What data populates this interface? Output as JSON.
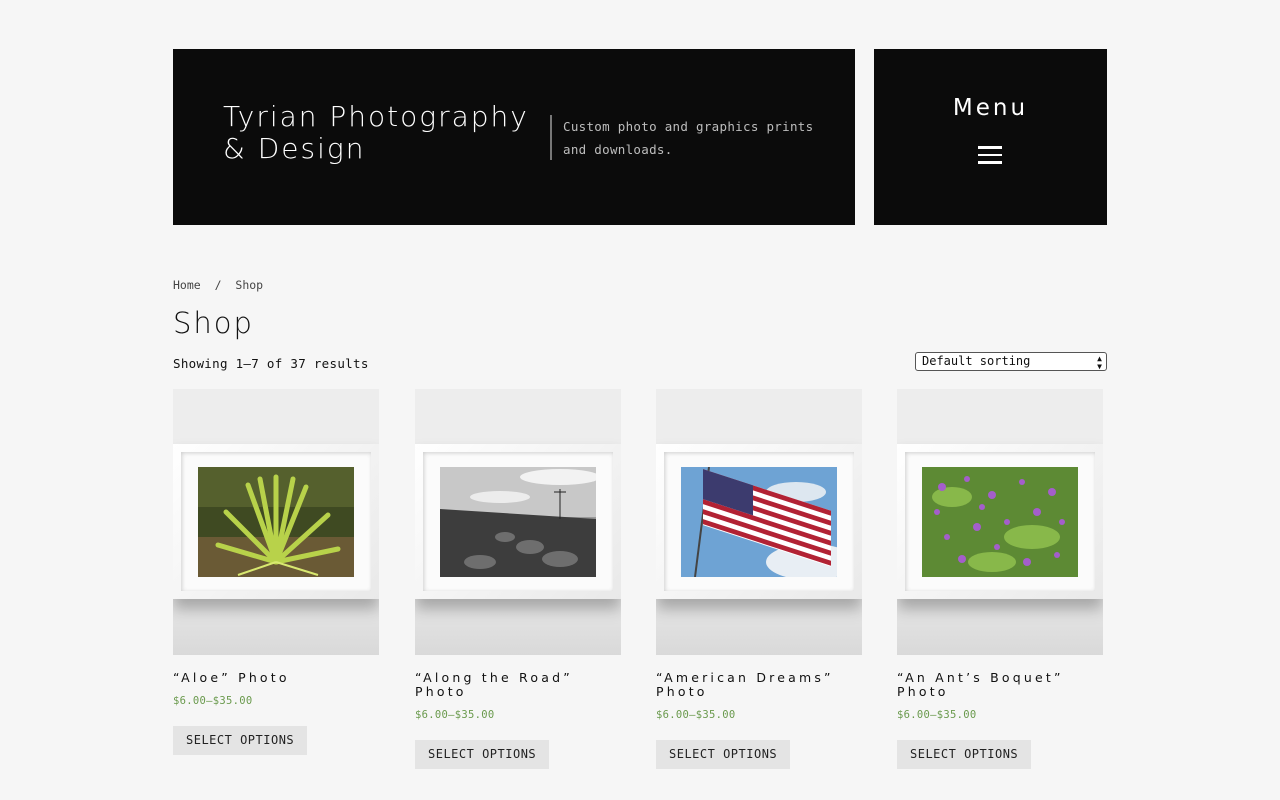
{
  "site": {
    "title": "Tyrian Photography & Design",
    "tagline": "Custom photo and graphics prints and downloads."
  },
  "menu": {
    "label": "Menu"
  },
  "breadcrumb": {
    "home": "Home",
    "separator": "/",
    "current": "Shop"
  },
  "page": {
    "title": "Shop",
    "result_count": "Showing 1–7 of 37 results"
  },
  "sorting": {
    "selected": "Default sorting"
  },
  "products": [
    {
      "title": "“Aloe” Photo",
      "price": "$6.00–$35.00",
      "button": "SELECT OPTIONS"
    },
    {
      "title": "“Along the Road” Photo",
      "price": "$6.00–$35.00",
      "button": "SELECT OPTIONS"
    },
    {
      "title": "“American Dreams” Photo",
      "price": "$6.00–$35.00",
      "button": "SELECT OPTIONS"
    },
    {
      "title": "“An Ant’s Boquet” Photo",
      "price": "$6.00–$35.00",
      "button": "SELECT OPTIONS"
    }
  ],
  "colors": {
    "header_bg": "#0b0b0b",
    "page_bg": "#f6f6f6",
    "price": "#6a9a4d",
    "button_bg": "#e4e4e4"
  }
}
